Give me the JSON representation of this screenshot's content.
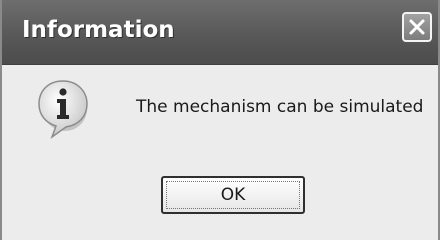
{
  "dialog": {
    "title": "Information",
    "message": "The mechanism can be simulated",
    "ok_label": "OK",
    "icon": "information-icon",
    "close_icon": "close-icon"
  },
  "colors": {
    "titlebar": "#5a5a5a",
    "body_background": "#ececec",
    "title_text": "#ffffff"
  }
}
